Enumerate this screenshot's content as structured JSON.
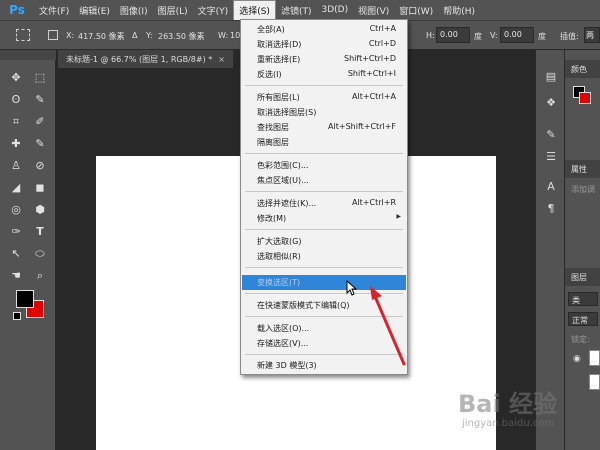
{
  "app": {
    "logo": "Ps"
  },
  "menubar": [
    {
      "label": "文件(F)"
    },
    {
      "label": "编辑(E)"
    },
    {
      "label": "图像(I)"
    },
    {
      "label": "图层(L)"
    },
    {
      "label": "文字(Y)"
    },
    {
      "label": "选择(S)"
    },
    {
      "label": "滤镜(T)"
    },
    {
      "label": "3D(D)"
    },
    {
      "label": "视图(V)"
    },
    {
      "label": "窗口(W)"
    },
    {
      "label": "帮助(H)"
    }
  ],
  "options": {
    "x_label": "X:",
    "x_value": "417.50 像素",
    "delta": "Δ",
    "y_label": "Y:",
    "y_value": "263.50 像素",
    "w_label": "W:",
    "w_value": "10",
    "h_label": "H:",
    "h_value": "0.00",
    "deg1": "度",
    "v_label": "V:",
    "v_value": "0.00",
    "deg2": "度",
    "interp_label": "插值:",
    "interp_value": "两"
  },
  "document": {
    "tab_title": "未标题-1 @ 66.7% (图层 1, RGB/8#) *",
    "close": "×"
  },
  "tools_glyphs": [
    "✥",
    "⬚",
    "ʘ",
    "✎",
    "⌗",
    "✐",
    "✚",
    "✎",
    "♙",
    "⊘",
    "◢",
    "◼",
    "◎",
    "⬢",
    "✑",
    "T",
    "↖",
    "⬭",
    "☚",
    "⌕"
  ],
  "right_panels": {
    "color_tab": "颜色",
    "properties_tab": "属性",
    "properties_hint": "添加调",
    "layers_tab": "图层",
    "layer_filter": "类",
    "blend_mode": "正常",
    "lock_label": "锁定:"
  },
  "select_menu": {
    "items": [
      {
        "label": "全部(A)",
        "shortcut": "Ctrl+A"
      },
      {
        "label": "取消选择(D)",
        "shortcut": "Ctrl+D"
      },
      {
        "label": "重新选择(E)",
        "shortcut": "Shift+Ctrl+D"
      },
      {
        "label": "反选(I)",
        "shortcut": "Shift+Ctrl+I"
      },
      {
        "label": "所有图层(L)",
        "shortcut": "Alt+Ctrl+A"
      },
      {
        "label": "取消选择图层(S)",
        "shortcut": ""
      },
      {
        "label": "查找图层",
        "shortcut": "Alt+Shift+Ctrl+F"
      },
      {
        "label": "隔离图层",
        "shortcut": ""
      },
      {
        "label": "色彩范围(C)...",
        "shortcut": ""
      },
      {
        "label": "焦点区域(U)...",
        "shortcut": ""
      },
      {
        "label": "选择并遮住(K)...",
        "shortcut": "Alt+Ctrl+R"
      },
      {
        "label": "修改(M)",
        "shortcut": ""
      },
      {
        "label": "扩大选取(G)",
        "shortcut": ""
      },
      {
        "label": "选取相似(R)",
        "shortcut": ""
      },
      {
        "label": "变换选区(T)",
        "shortcut": ""
      },
      {
        "label": "在快速蒙版模式下编辑(Q)",
        "shortcut": ""
      },
      {
        "label": "载入选区(O)...",
        "shortcut": ""
      },
      {
        "label": "存储选区(V)...",
        "shortcut": ""
      },
      {
        "label": "新建 3D 模型(3)",
        "shortcut": ""
      }
    ]
  },
  "watermark": {
    "text": "Bai 经验",
    "sub": "jingyan.baidu.com"
  },
  "colors": {
    "highlight": "#2f85d8",
    "annotation_arrow": "#d8232a",
    "foreground": "#000000",
    "background": "#e00000"
  }
}
